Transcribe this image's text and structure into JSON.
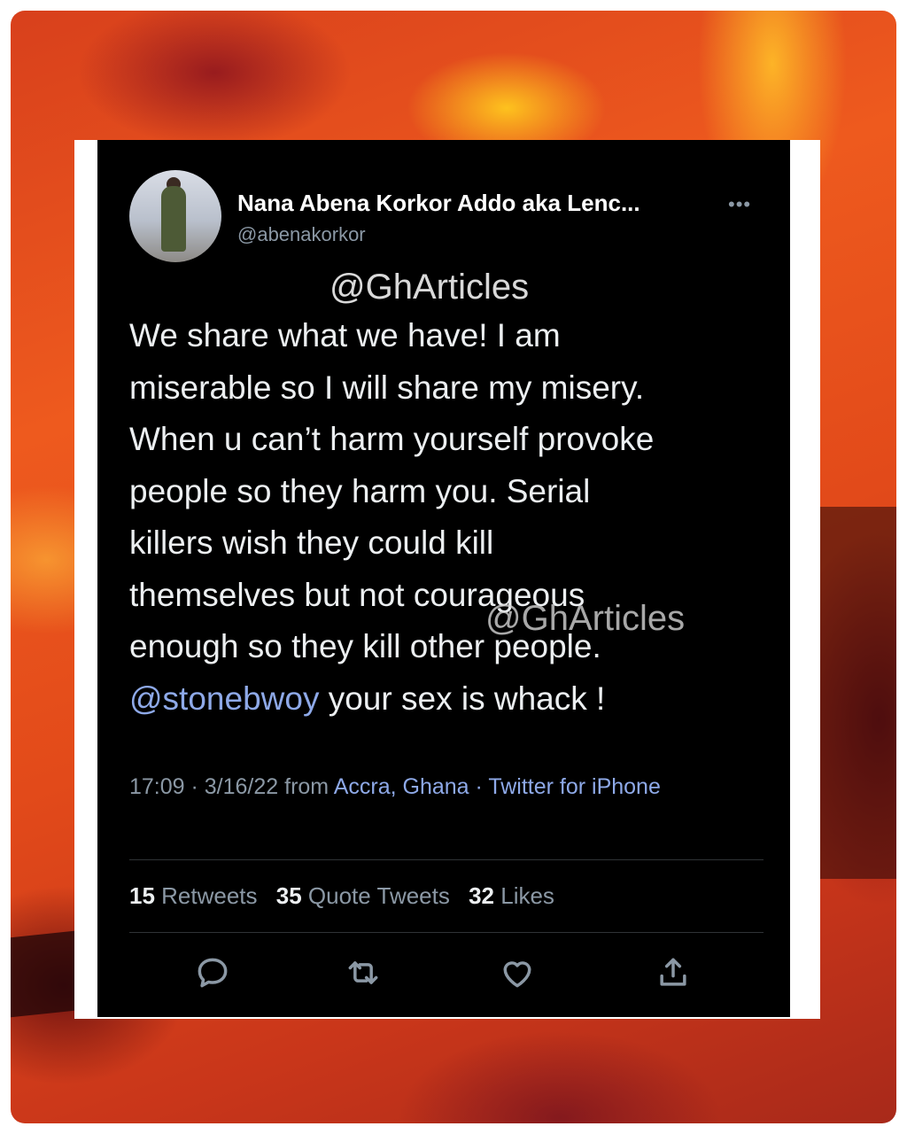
{
  "watermark": "@GhArticles",
  "tweet": {
    "display_name": "Nana Abena Korkor Addo aka Lenc...",
    "handle": "@abenakorkor",
    "more_icon": "more-horizontal-icon",
    "text_lines": [
      "We share what we have! I am",
      "miserable so I will share my misery.",
      "When u can’t harm yourself provoke",
      "people so they harm you. Serial",
      "killers wish they could kill",
      "themselves but not courageous",
      "enough so they kill other people."
    ],
    "mention": "@stonebwoy",
    "last_line_rest": " your sex is whack !",
    "time": "17:09 · 3/16/22 from ",
    "location": "Accra, Ghana",
    "separator": " · ",
    "source": "Twitter for iPhone",
    "stats": {
      "retweets_count": "15",
      "retweets_label": " Retweets",
      "quotes_count": "35",
      "quotes_label": " Quote Tweets",
      "likes_count": "32",
      "likes_label": " Likes"
    },
    "actions": [
      "reply-icon",
      "retweet-icon",
      "like-icon",
      "share-icon"
    ]
  }
}
